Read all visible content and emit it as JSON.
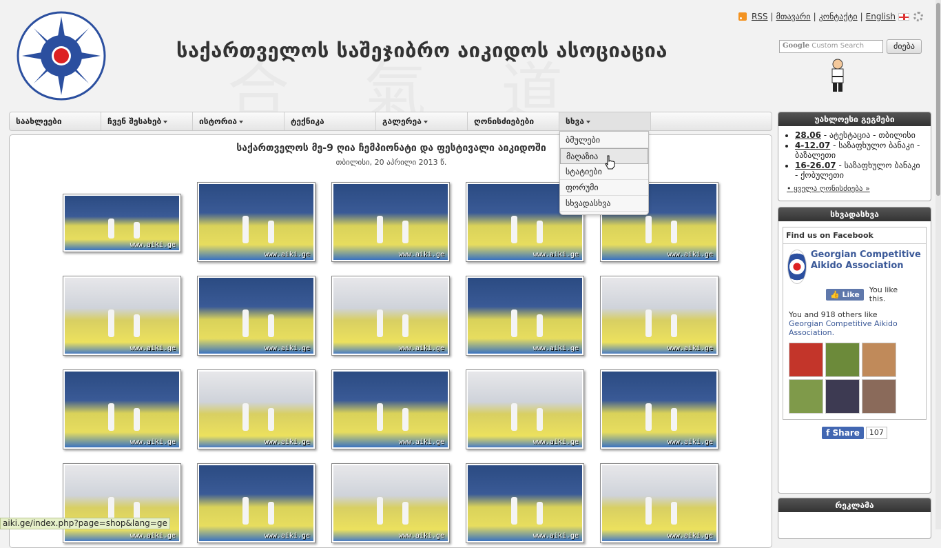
{
  "header": {
    "site_title": "საქართველოს საშეჯიბრო აიკიდოს ასოციაცია",
    "top_links": {
      "rss": "RSS",
      "site_map": "მთავარი",
      "contact": "კონტაქტი",
      "english": "English"
    },
    "search": {
      "placeholder_brand": "Google",
      "placeholder_text": "Custom Search",
      "button_label": "ძიება"
    }
  },
  "nav": {
    "items": [
      {
        "label": "საახლეები",
        "has_caret": false
      },
      {
        "label": "ჩვენ შესახებ",
        "has_caret": true
      },
      {
        "label": "ისტორია",
        "has_caret": true
      },
      {
        "label": "ტექნიკა",
        "has_caret": false
      },
      {
        "label": "გალერეა",
        "has_caret": true
      },
      {
        "label": "ღონისძიებები",
        "has_caret": false
      },
      {
        "label": "სხვა",
        "has_caret": true
      }
    ],
    "dropdown": [
      "ბმულები",
      "მაღაზია",
      "სტატიები",
      "ფორუმი",
      "სხვადასხვა"
    ]
  },
  "main": {
    "title": "საქართველოს მე-9 ღია ჩემპიონატი და ფესტივალი აიკიდოში",
    "subtitle": "თბილისი, 20 აპრილი 2013 წ.",
    "watermark": "www.aiki.ge"
  },
  "sidebar": {
    "events": {
      "title": "უახლოესი გეგმები",
      "items": [
        {
          "date": "28.06",
          "text": " - ატესტაცია - თბილისი"
        },
        {
          "date": "4-12.07",
          "text": " - საზაფხულო ბანაკი - ბაზალეთი"
        },
        {
          "date": "16-26.07",
          "text": " - საზაფხულო ბანაკი - ქობულეთი"
        }
      ],
      "all_link": "• ყველა ღონისძიება »"
    },
    "misc": {
      "title": "სხვადასხვა",
      "facebook": {
        "header": "Find us on Facebook",
        "page_name": "Georgian Competitive Aikido Association",
        "like_label": "Like",
        "you_like": "You like this.",
        "count_text": "You and 918 others like",
        "count_link": "Georgian Competitive Aikido Association.",
        "share_label": "Share",
        "share_count": "107"
      }
    },
    "ads": {
      "title": "რეკლამა"
    }
  },
  "status_bar": "aiki.ge/index.php?page=shop&lang=ge",
  "colors": {
    "accent_blue": "#2b4f9f",
    "accent_red": "#d22222",
    "facebook_blue": "#3b5998"
  }
}
